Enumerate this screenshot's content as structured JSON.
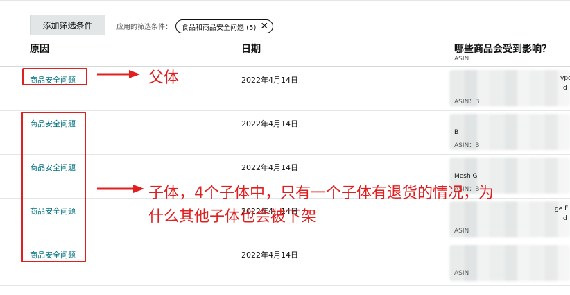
{
  "toolbar": {
    "add_filter_label": "添加筛选条件",
    "applied_filters_label": "应用的筛选条件：",
    "chip_label": "食品和商品安全问题 (5)"
  },
  "table": {
    "headers": {
      "reason": "原因",
      "date": "日期",
      "affected": "哪些商品会受到影响？",
      "affected_sub": "ASIN"
    },
    "rows": [
      {
        "reason": "商品安全问题",
        "date": "2022年4月14日",
        "asin": "ASIN：B",
        "frag1": "ype",
        "frag2": "d"
      },
      {
        "reason": "商品安全问题",
        "date": "2022年4月14日",
        "asin": "ASIN：B",
        "frag1": "B",
        "frag2": ""
      },
      {
        "reason": "商品安全问题",
        "date": "2022年4月14日",
        "asin": "ASIN：B",
        "frag1": "Mesh G",
        "frag2": ""
      },
      {
        "reason": "商品安全问题",
        "date": "2022年4月14日",
        "asin": "ASIN",
        "frag1": "ge F",
        "frag2": "d"
      },
      {
        "reason": "商品安全问题",
        "date": "2022年4月14日",
        "asin": "ASIN",
        "frag1": "",
        "frag2": ""
      }
    ]
  },
  "annotations": {
    "parent_label": "父体",
    "children_note_line1": "子体，4个子体中，只有一个子体有退货的情况，为",
    "children_note_line2": "什么其他子体也会被下架",
    "color": "#e02020"
  }
}
